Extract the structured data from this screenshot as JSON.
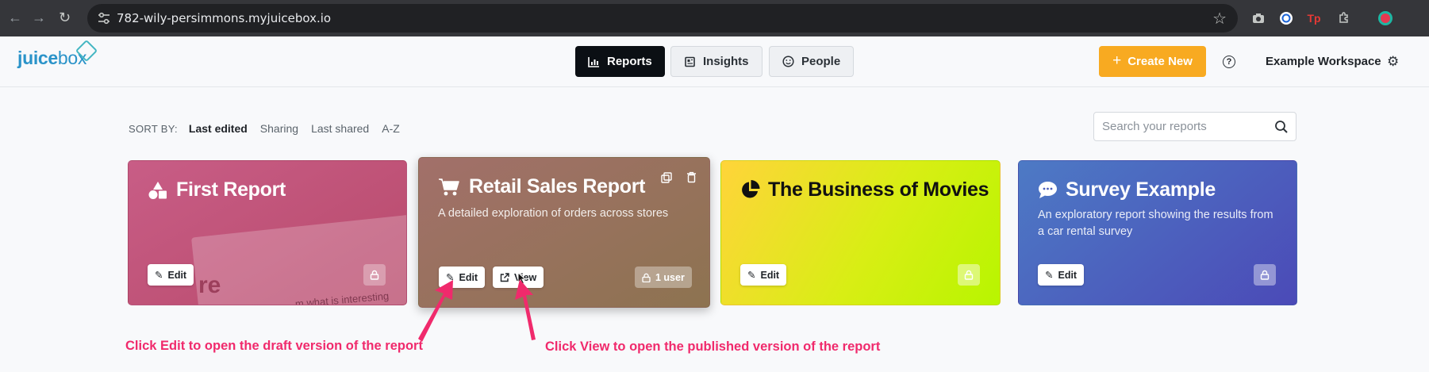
{
  "browser": {
    "url": "782-wily-persimmons.myjuicebox.io"
  },
  "app": {
    "logo_prefix": "juice",
    "logo_suffix": "box",
    "tabs": [
      {
        "label": "Reports",
        "icon": "bar-chart-icon",
        "active": true
      },
      {
        "label": "Insights",
        "icon": "newspaper-icon",
        "active": false
      },
      {
        "label": "People",
        "icon": "smiley-icon",
        "active": false
      }
    ],
    "create_label": "Create New",
    "help_glyph": "?",
    "workspace": "Example Workspace"
  },
  "sort": {
    "label": "SORT BY:",
    "options": [
      "Last edited",
      "Sharing",
      "Last shared",
      "A-Z"
    ],
    "selected": "Last edited"
  },
  "search": {
    "placeholder": "Search your reports",
    "value": ""
  },
  "cards": [
    {
      "title": "First Report",
      "description": "",
      "edit": "Edit",
      "preview_text_big": "re",
      "preview_text_small": "...m what is interesting",
      "icon": "shapes-icon"
    },
    {
      "title": "Retail Sales Report",
      "description": "A detailed exploration of orders across stores",
      "edit": "Edit",
      "view": "View",
      "share": "1 user",
      "icon": "cart-icon"
    },
    {
      "title": "The Business of Movies",
      "description": "",
      "edit": "Edit",
      "icon": "pie-chart-icon"
    },
    {
      "title": "Survey Example",
      "description": "An exploratory report showing the results from a car rental survey",
      "edit": "Edit",
      "icon": "chat-bubble-icon"
    }
  ],
  "annotations": {
    "edit_hint": "Click Edit to open the draft version of the report",
    "view_hint": "Click View to open the published version of the report"
  },
  "colors": {
    "accent": "#f8aa21",
    "annotation": "#f02a6c",
    "active_tab": "#0b0f14",
    "logo": "#2a93c9"
  }
}
